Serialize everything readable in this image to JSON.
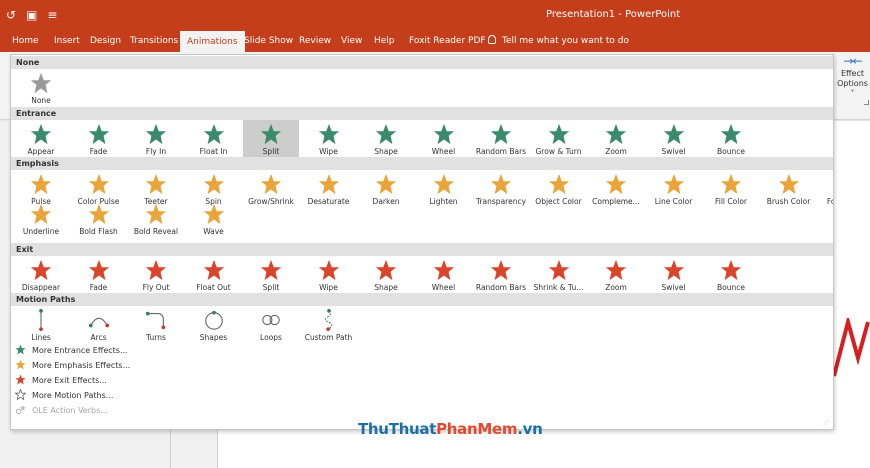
{
  "titlebar": {
    "title": "Presentation1 - PowerPoint",
    "background": "#c43e1c"
  },
  "quick_access": [
    {
      "icon": "undo-icon"
    },
    {
      "icon": "presenter-icon"
    },
    {
      "icon": "customize-qat-icon"
    }
  ],
  "tabs": [
    {
      "label": "Home",
      "active": false
    },
    {
      "label": "Insert",
      "active": false
    },
    {
      "label": "Design",
      "active": false
    },
    {
      "label": "Transitions",
      "active": false
    },
    {
      "label": "Animations",
      "active": true
    },
    {
      "label": "Slide Show",
      "active": false
    },
    {
      "label": "Review",
      "active": false
    },
    {
      "label": "View",
      "active": false
    },
    {
      "label": "Help",
      "active": false
    },
    {
      "label": "Foxit Reader PDF",
      "active": false
    }
  ],
  "tell_me": "Tell me what you want to do",
  "effect_options": {
    "line1": "Effect",
    "line2": "Options ˅"
  },
  "gallery": {
    "sections": {
      "none": "None",
      "entrance": "Entrance",
      "emphasis": "Emphasis",
      "exit": "Exit",
      "motion_paths": "Motion Paths"
    },
    "none_items": [
      {
        "label": "None"
      }
    ],
    "entrance_items": [
      {
        "label": "Appear"
      },
      {
        "label": "Fade"
      },
      {
        "label": "Fly In"
      },
      {
        "label": "Float In"
      },
      {
        "label": "Split",
        "selected": true
      },
      {
        "label": "Wipe"
      },
      {
        "label": "Shape"
      },
      {
        "label": "Wheel"
      },
      {
        "label": "Random Bars"
      },
      {
        "label": "Grow & Turn"
      },
      {
        "label": "Zoom"
      },
      {
        "label": "Swivel"
      },
      {
        "label": "Bounce"
      }
    ],
    "emphasis_items_row1": [
      {
        "label": "Pulse"
      },
      {
        "label": "Color Pulse"
      },
      {
        "label": "Teeter"
      },
      {
        "label": "Spin"
      },
      {
        "label": "Grow/Shrink"
      },
      {
        "label": "Desaturate"
      },
      {
        "label": "Darken"
      },
      {
        "label": "Lighten"
      },
      {
        "label": "Transparency"
      },
      {
        "label": "Object Color"
      },
      {
        "label": "Compleme..."
      },
      {
        "label": "Line Color"
      },
      {
        "label": "Fill Color"
      },
      {
        "label": "Brush Color"
      },
      {
        "label": "Font Color"
      }
    ],
    "emphasis_items_row2": [
      {
        "label": "Underline"
      },
      {
        "label": "Bold Flash"
      },
      {
        "label": "Bold Reveal"
      },
      {
        "label": "Wave"
      }
    ],
    "exit_items": [
      {
        "label": "Disappear"
      },
      {
        "label": "Fade"
      },
      {
        "label": "Fly Out"
      },
      {
        "label": "Float Out"
      },
      {
        "label": "Split"
      },
      {
        "label": "Wipe"
      },
      {
        "label": "Shape"
      },
      {
        "label": "Wheel"
      },
      {
        "label": "Random Bars"
      },
      {
        "label": "Shrink & Tu..."
      },
      {
        "label": "Zoom"
      },
      {
        "label": "Swivel"
      },
      {
        "label": "Bounce"
      }
    ],
    "motion_items": [
      {
        "label": "Lines"
      },
      {
        "label": "Arcs"
      },
      {
        "label": "Turns"
      },
      {
        "label": "Shapes"
      },
      {
        "label": "Loops"
      },
      {
        "label": "Custom Path"
      }
    ],
    "more": [
      {
        "label": "More Entrance Effects...",
        "icon": "green-star-icon",
        "disabled": false
      },
      {
        "label": "More Emphasis Effects...",
        "icon": "gold-star-icon",
        "disabled": false
      },
      {
        "label": "More Exit Effects...",
        "icon": "red-star-icon",
        "disabled": false
      },
      {
        "label": "More Motion Paths...",
        "icon": "outline-star-icon",
        "disabled": false
      },
      {
        "label": "OLE Action Verbs...",
        "icon": "ole-verbs-icon",
        "disabled": true
      }
    ]
  },
  "colors": {
    "entrance": "#3a8a6e",
    "emphasis": "#e9a53a",
    "exit": "#d9452b",
    "selected": "#cdcdcd"
  },
  "watermark": {
    "part1": "ThuThuat",
    "part2": "PhanMem",
    "part3": ".vn"
  }
}
